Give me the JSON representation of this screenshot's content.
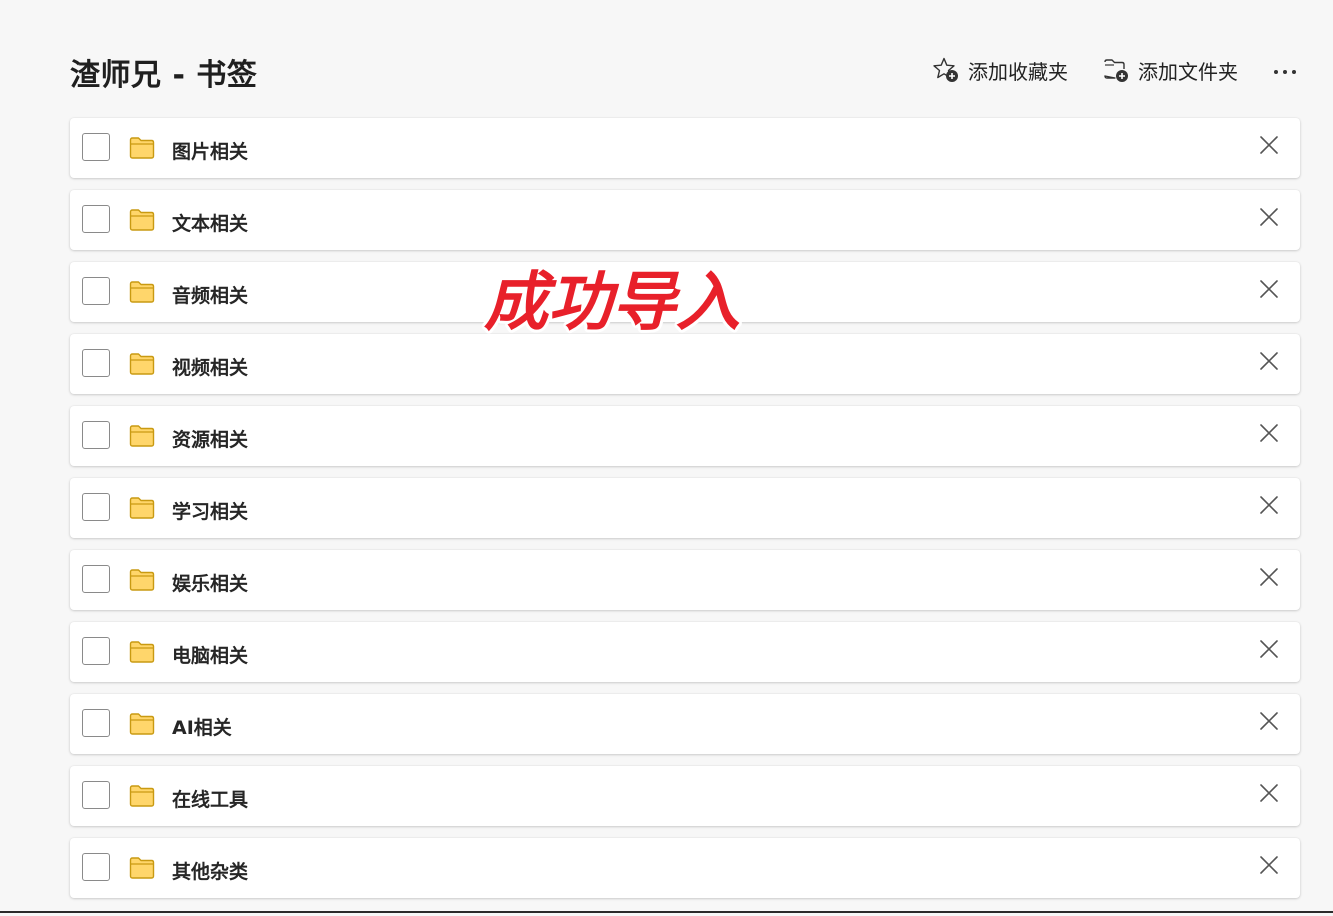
{
  "header": {
    "title": "渣师兄 - 书签",
    "add_favorite_label": "添加收藏夹",
    "add_folder_label": "添加文件夹",
    "more_icon": "more-horizontal-icon"
  },
  "folders": [
    {
      "label": "图片相关"
    },
    {
      "label": "文本相关"
    },
    {
      "label": "音频相关"
    },
    {
      "label": "视频相关"
    },
    {
      "label": "资源相关"
    },
    {
      "label": "学习相关"
    },
    {
      "label": "娱乐相关"
    },
    {
      "label": "电脑相关"
    },
    {
      "label": "AI相关"
    },
    {
      "label": "在线工具"
    },
    {
      "label": "其他杂类"
    }
  ],
  "overlay": {
    "text": "成功导入",
    "color": "#e8202a"
  },
  "colors": {
    "folder_fill": "#ffd66b",
    "folder_stroke": "#c99a12",
    "background": "#f7f7f7"
  }
}
